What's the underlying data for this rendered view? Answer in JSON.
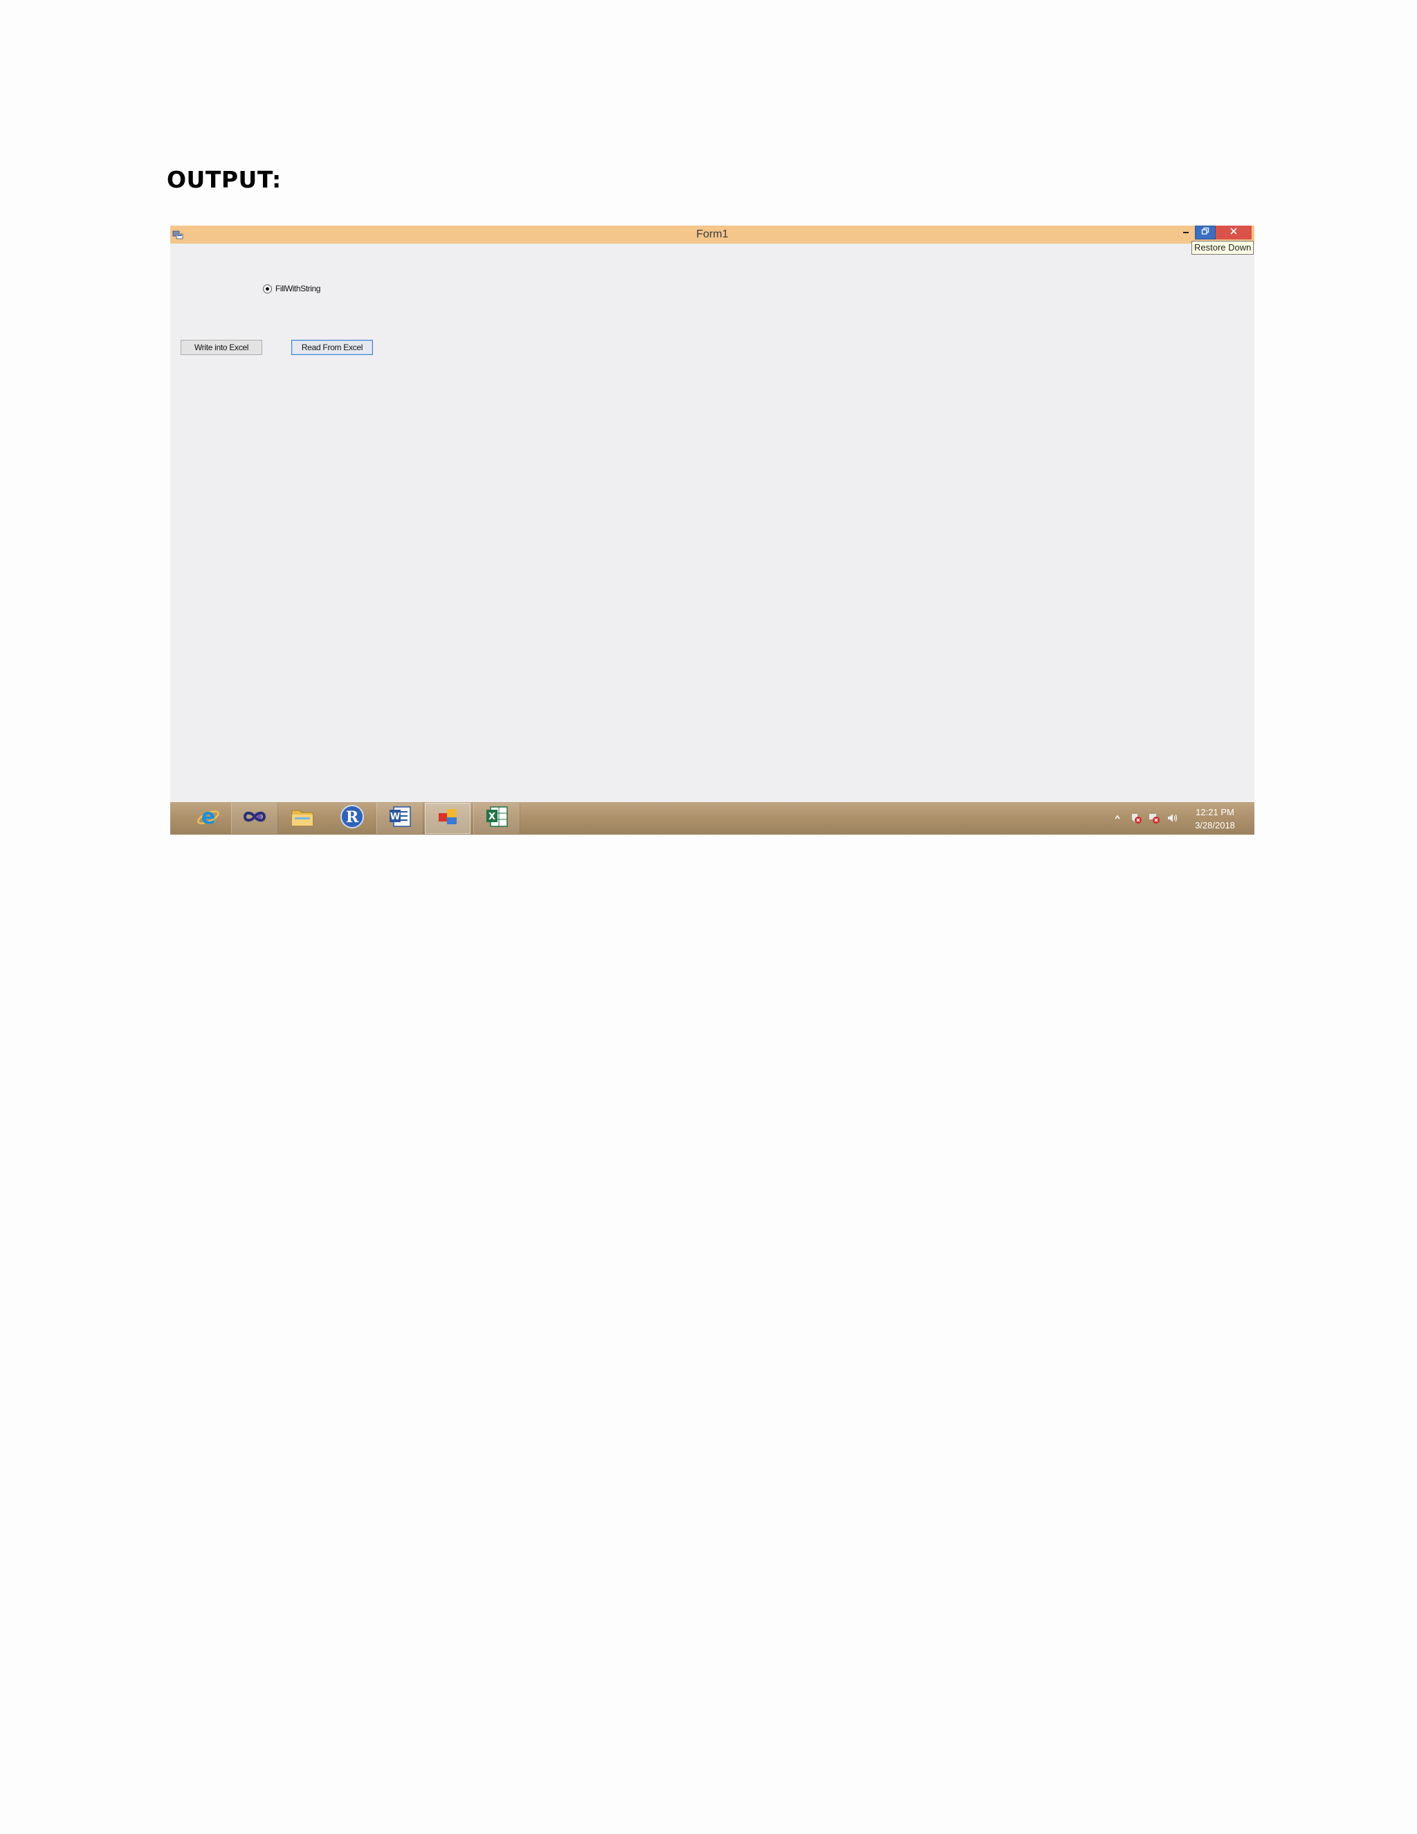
{
  "document": {
    "heading": "OUTPUT:"
  },
  "window": {
    "title": "Form1",
    "app_icon": "form-app-icon",
    "controls": {
      "minimize": "minimize-icon",
      "restore": "restore-icon",
      "close": "close-icon"
    },
    "tooltip": "Restore Down"
  },
  "form": {
    "radio": {
      "label": "FillWithString",
      "checked": true
    },
    "buttons": {
      "write_label": "Write into Excel",
      "read_label": "Read From Excel"
    }
  },
  "taskbar": {
    "apps": [
      {
        "name": "internet-explorer-icon",
        "state": "pinned"
      },
      {
        "name": "visual-studio-icon",
        "state": "running"
      },
      {
        "name": "file-explorer-icon",
        "state": "pinned"
      },
      {
        "name": "r-icon",
        "state": "pinned"
      },
      {
        "name": "word-icon",
        "state": "running"
      },
      {
        "name": "form-app-icon",
        "state": "active"
      },
      {
        "name": "excel-icon",
        "state": "running"
      }
    ],
    "tray_icons": [
      "show-hidden-icons-chevron",
      "action-center-error-icon",
      "network-error-icon",
      "volume-icon"
    ],
    "clock": {
      "time": "12:21 PM",
      "date": "3/28/2018"
    }
  },
  "colors": {
    "titlebar": "#f4c68c",
    "form_background": "#efeff1",
    "taskbar": "#ad926c",
    "restore_button": "#3b6fc4",
    "close_button": "#d9534a"
  }
}
